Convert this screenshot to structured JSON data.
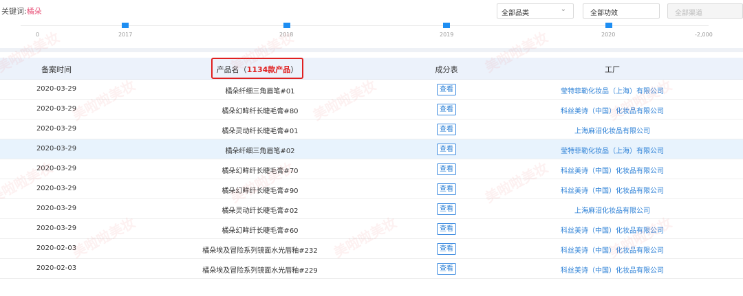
{
  "filters": {
    "keyword_label": "关键词:",
    "keyword_value": "橘朵",
    "category": "全部品类",
    "effect": "全部功效",
    "channel": "全部渠道"
  },
  "timeline": {
    "left_value": "0",
    "right_value": "-2,000",
    "years": [
      "2017",
      "2018",
      "2019",
      "2020"
    ]
  },
  "table": {
    "headers": {
      "date": "备案时间",
      "name_prefix": "产品名（",
      "name_count": "1134款产品",
      "name_suffix": "）",
      "ingredients": "成分表",
      "factory": "工厂"
    },
    "view_label": "查看",
    "rows": [
      {
        "date": "2020-03-29",
        "name": "橘朵纤细三角眉笔#01",
        "factory": "莹特菲勒化妆品（上海）有限公司"
      },
      {
        "date": "2020-03-29",
        "name": "橘朵幻眸纤长睫毛膏#80",
        "factory": "科丝美诗（中国）化妆品有限公司"
      },
      {
        "date": "2020-03-29",
        "name": "橘朵灵动纤长睫毛膏#01",
        "factory": "上海麻沼化妆品有限公司"
      },
      {
        "date": "2020-03-29",
        "name": "橘朵纤细三角眉笔#02",
        "factory": "莹特菲勒化妆品（上海）有限公司"
      },
      {
        "date": "2020-03-29",
        "name": "橘朵幻眸纤长睫毛膏#70",
        "factory": "科丝美诗（中国）化妆品有限公司"
      },
      {
        "date": "2020-03-29",
        "name": "橘朵幻眸纤长睫毛膏#90",
        "factory": "科丝美诗（中国）化妆品有限公司"
      },
      {
        "date": "2020-03-29",
        "name": "橘朵灵动纤长睫毛膏#02",
        "factory": "上海麻沼化妆品有限公司"
      },
      {
        "date": "2020-03-29",
        "name": "橘朵幻眸纤长睫毛膏#60",
        "factory": "科丝美诗（中国）化妆品有限公司"
      },
      {
        "date": "2020-02-03",
        "name": "橘朵埃及冒险系列镜面水光唇釉#232",
        "factory": "科丝美诗（中国）化妆品有限公司"
      },
      {
        "date": "2020-02-03",
        "name": "橘朵埃及冒险系列镜面水光唇釉#229",
        "factory": "科丝美诗（中国）化妆品有限公司"
      }
    ]
  },
  "watermark": "美啦啦美妆"
}
